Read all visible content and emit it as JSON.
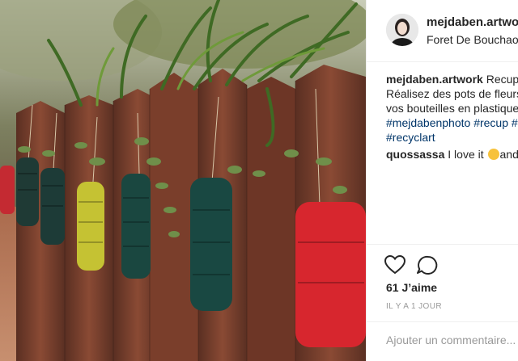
{
  "post": {
    "username": "mejdaben.artwork",
    "location": "Foret De Bouchaoui",
    "caption_lines": [
      "Recup",
      "Réalisez des pots de fleurs",
      "vos bouteilles en plastique"
    ],
    "hashtags_line1": "#mejdabenphoto #recup #",
    "hashtags_line2": "#recyclart",
    "comment": {
      "username": "quossassa",
      "text": "I love it",
      "tail": "and"
    },
    "likes": "61 J’aime",
    "time_ago": "IL Y A 1 JOUR",
    "add_comment_placeholder": "Ajouter un commentaire..."
  },
  "icons": [
    "heart-icon",
    "comment-icon",
    "smiling-face-emoji"
  ]
}
